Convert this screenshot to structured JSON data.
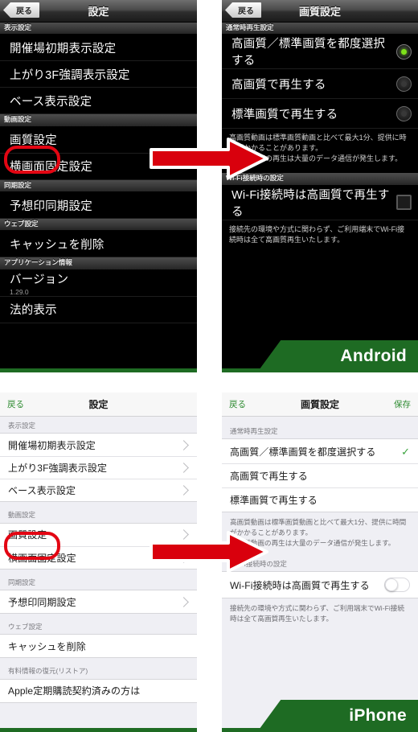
{
  "labels": {
    "back": "戻る",
    "save": "保存",
    "settings_title": "設定",
    "quality_title": "画質設定",
    "android_banner": "Android",
    "iphone_banner": "iPhone"
  },
  "settings_screen": {
    "title": "設定",
    "back": "戻る",
    "sections": [
      {
        "header": "表示設定",
        "rows": [
          {
            "label": "開催場初期表示設定"
          },
          {
            "label": "上がり3F強調表示設定"
          },
          {
            "label": "ベース表示設定"
          }
        ]
      },
      {
        "header": "動画設定",
        "rows": [
          {
            "label": "画質設定",
            "highlighted": true
          },
          {
            "label": "横画面固定設定"
          }
        ]
      },
      {
        "header": "同期設定",
        "rows": [
          {
            "label": "予想印同期設定"
          }
        ]
      },
      {
        "header": "ウェブ設定",
        "rows": [
          {
            "label": "キャッシュを削除"
          }
        ]
      },
      {
        "header": "アプリケーション情報",
        "rows": [
          {
            "label": "バージョン",
            "sub": "1.29.0"
          },
          {
            "label": "法的表示"
          }
        ]
      },
      {
        "header": "有料情報の復元(リストア)",
        "rows": [
          {
            "label": "Apple定期購読契約済みの方は"
          }
        ]
      }
    ]
  },
  "quality_screen": {
    "title": "画質設定",
    "back": "戻る",
    "save": "保存",
    "playback_section_header": "通常時再生設定",
    "options": [
      {
        "label": "高画質／標準画質を都度選択する",
        "selected": true
      },
      {
        "label": "高画質で再生する",
        "selected": false
      },
      {
        "label": "標準画質で再生する",
        "selected": false
      }
    ],
    "playback_note_lines": [
      "高画質動画は標準画質動画と比べて最大1分、提供に時間がかかることがあります。",
      "高画質動画の再生は大量のデータ通信が発生します。"
    ],
    "wifi_section_header": "Wi-Fi接続時の設定",
    "wifi_row": {
      "label": "Wi-Fi接続時は高画質で再生する",
      "checked": false
    },
    "wifi_note": "接続先の環境や方式に関わらず、ご利用端末でWi-Fi接続時は全て高画質再生いたします。"
  },
  "colors": {
    "brand_green": "#1e6b23",
    "accent_red": "#e30613",
    "android_bg": "#000000",
    "ios_bg": "#efeff4",
    "ios_link_green": "#2e8b31",
    "radio_on_green": "#7ee21a"
  },
  "icons": {
    "arrow_right": "right-arrow-icon",
    "chevron": "chevron-right-icon",
    "check": "check-icon"
  }
}
